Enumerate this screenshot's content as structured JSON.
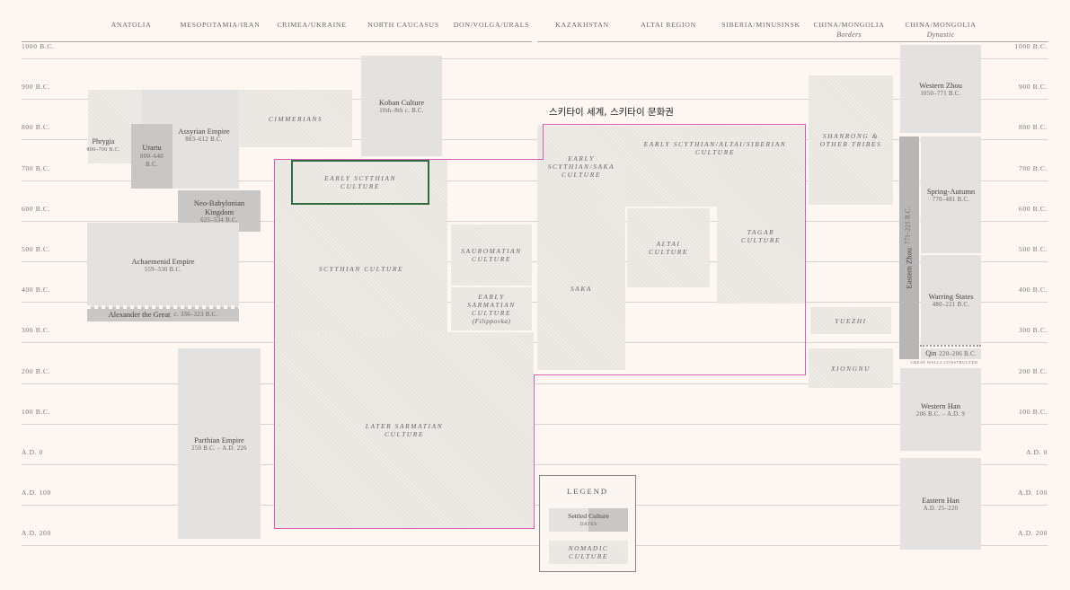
{
  "headers": [
    {
      "name": "Anatolia"
    },
    {
      "name": "Mesopotamia/Iran"
    },
    {
      "name": "Crimea/Ukraine"
    },
    {
      "name": "North Caucasus"
    },
    {
      "name": "Don/Volga/Urals"
    },
    {
      "name": "Kazakhstan"
    },
    {
      "name": "Altai Region"
    },
    {
      "name": "Siberia/Minusinsk"
    },
    {
      "name": "China/Mongolia",
      "sub": "Borders"
    },
    {
      "name": "China/Mongolia",
      "sub": "Dynastic"
    }
  ],
  "time_left": [
    "1000 B.C.",
    "900 B.C.",
    "800 B.C.",
    "700 B.C.",
    "600 B.C.",
    "500 B.C.",
    "400 B.C.",
    "300 B.C.",
    "200 B.C.",
    "100 B.C.",
    "A.D. 0",
    "A.D. 100",
    "A.D. 200"
  ],
  "time_right": [
    "1000 B.C.",
    "900 B.C.",
    "800 B.C.",
    "700 B.C.",
    "600 B.C.",
    "500 B.C.",
    "400 B.C.",
    "300 B.C.",
    "200 B.C.",
    "100 B.C.",
    "A.D. 0",
    "A.D. 100",
    "A.D. 200"
  ],
  "cultures": {
    "phrygia": {
      "name": "Phrygia",
      "dates": "800–700 B.C."
    },
    "urartu": {
      "name": "Urartu",
      "dates": "800–640 B.C."
    },
    "assyrian": {
      "name": "Assyrian Empire",
      "dates": "883–612 B.C."
    },
    "cimmerians": {
      "name": "Cimmerians"
    },
    "koban": {
      "name": "Koban Culture",
      "dates": "10th–8th c. B.C."
    },
    "neo_babylonian": {
      "name": "Neo-Babylonian Kingdom",
      "dates": "625–534 B.C."
    },
    "achaemenid": {
      "name": "Achaemenid Empire",
      "dates": "559–330 B.C."
    },
    "alexander": {
      "name": "Alexander the Great",
      "dates": "c. 336–323 B.C."
    },
    "parthian": {
      "name": "Parthian Empire",
      "dates": "250 B.C. – A.D. 226"
    },
    "early_scythian": {
      "name": "Early Scythian Culture"
    },
    "scythian": {
      "name": "Scythian Culture"
    },
    "sauromatian": {
      "name": "Sauromatian Culture"
    },
    "early_sarmatian": {
      "name": "Early Sarmatian Culture",
      "sub": "(Filippovka)"
    },
    "later_sarmatian": {
      "name": "Later Sarmatian Culture"
    },
    "early_saka": {
      "name": "Early Scythian/Saka Culture"
    },
    "early_altai": {
      "name": "Early Scythian/Altai/Siberian Culture"
    },
    "altai": {
      "name": "Altai Culture"
    },
    "tagar": {
      "name": "Tagar Culture"
    },
    "saka": {
      "name": "Saka"
    },
    "shanrong": {
      "name": "Shanrong & Other Tribes"
    },
    "yuezhi": {
      "name": "Yuezhi"
    },
    "xiongnu": {
      "name": "Xiongnu"
    },
    "western_zhou": {
      "name": "Western Zhou",
      "dates": "1050–771 B.C."
    },
    "eastern_zhou": {
      "name": "Eastern Zhou",
      "dates": "771–221 B.C."
    },
    "spring_autumn": {
      "name": "Spring-Autumn",
      "dates": "770–481 B.C."
    },
    "warring_states": {
      "name": "Warring States",
      "dates": "480–221 B.C."
    },
    "qin": {
      "name": "Qin",
      "dates": "220–206 B.C."
    },
    "great_walls": {
      "text": "Great Walls Constructed"
    },
    "western_han": {
      "name": "Western Han",
      "dates": "206 B.C. – A.D. 9"
    },
    "eastern_han": {
      "name": "Eastern Han",
      "dates": "A.D. 25–220"
    }
  },
  "annotation": {
    "text": "스키타이 세계, 스키타이 문화권"
  },
  "legend": {
    "title": "Legend",
    "settled": "Settled Culture",
    "dates": "Dates",
    "nomadic": "Nomadic Culture"
  },
  "colors": {
    "highlight_outline": "#d65fb5",
    "selected_box": "#2f6b3e",
    "settled": "#e4e2e0",
    "nomadic": "#eeeae6"
  }
}
